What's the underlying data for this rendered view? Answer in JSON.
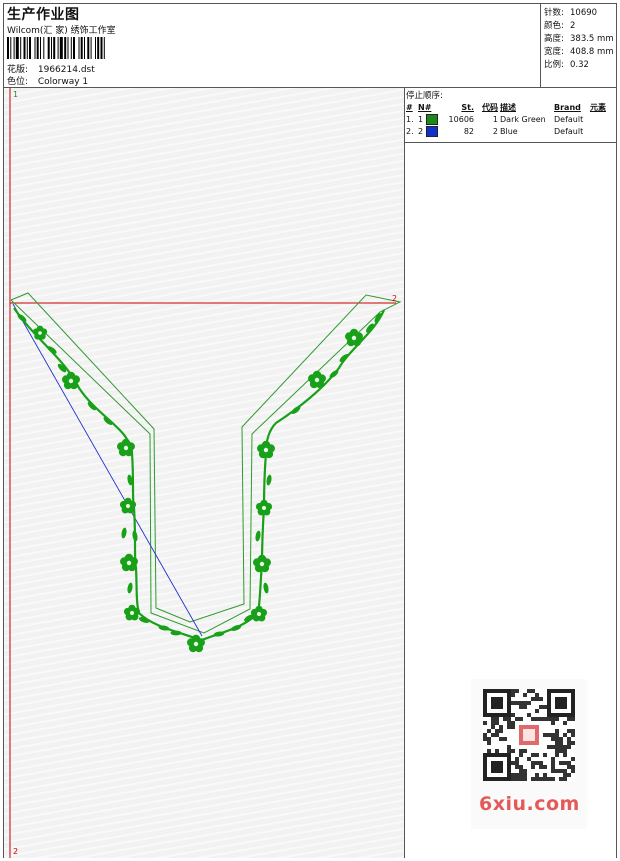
{
  "header": {
    "title": "生产作业图",
    "studio": "Wilcom(汇 家) 绣饰工作室",
    "design_label": "花版:",
    "design_value": "1966214.dst",
    "colorway_label": "色位:",
    "colorway_value": "Colorway 1"
  },
  "stats": [
    {
      "label": "针数:",
      "value": "10690"
    },
    {
      "label": "颜色:",
      "value": "2"
    },
    {
      "label": "高度:",
      "value": "383.5 mm"
    },
    {
      "label": "宽度:",
      "value": "408.8 mm"
    },
    {
      "label": "比例:",
      "value": "0.32"
    }
  ],
  "stop_sequence": {
    "title": "停止顺序:",
    "columns": [
      "#",
      "N#",
      "St.",
      "代码",
      "描述",
      "Brand",
      "元素"
    ],
    "rows": [
      {
        "idx": "1.",
        "n": "1",
        "color": "#1a8a1a",
        "stitches": "10606",
        "code": "1",
        "description": "Dark Green",
        "brand": "Default"
      },
      {
        "idx": "2.",
        "n": "2",
        "color": "#1030d0",
        "stitches": "82",
        "code": "2",
        "description": "Blue",
        "brand": "Default"
      }
    ]
  },
  "canvas": {
    "marker_start": "1",
    "marker_end": "2",
    "marker_bottom": "2",
    "colors": {
      "outline": "#2e9a2e",
      "embroidery": "#18a018",
      "jump": "#2030d0",
      "guide": "#cc0000"
    }
  },
  "watermark": {
    "brand": "6xiu.com",
    "qr_icon": "qr-code-icon"
  }
}
